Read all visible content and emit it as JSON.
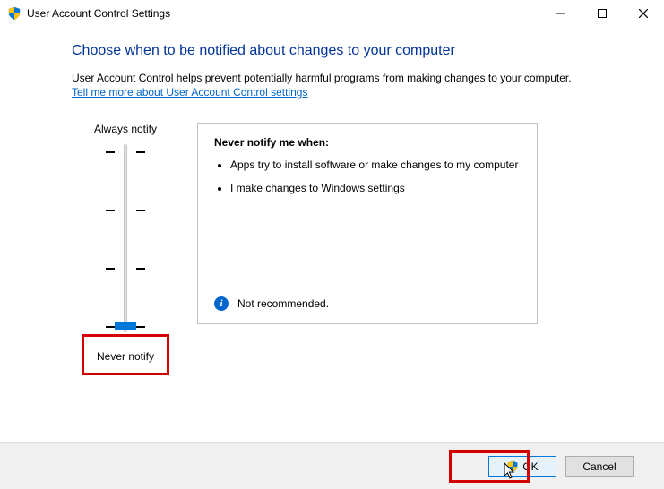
{
  "window": {
    "title": "User Account Control Settings"
  },
  "heading": "Choose when to be notified about changes to your computer",
  "body_text": "User Account Control helps prevent potentially harmful programs from making changes to your computer.",
  "help_link": "Tell me more about User Account Control settings",
  "slider": {
    "top_label": "Always notify",
    "bottom_label": "Never notify",
    "position": 3
  },
  "panel": {
    "title": "Never notify me when:",
    "bullets": [
      "Apps try to install software or make changes to my computer",
      "I make changes to Windows settings"
    ],
    "recommendation": "Not recommended."
  },
  "buttons": {
    "ok": "OK",
    "cancel": "Cancel"
  }
}
